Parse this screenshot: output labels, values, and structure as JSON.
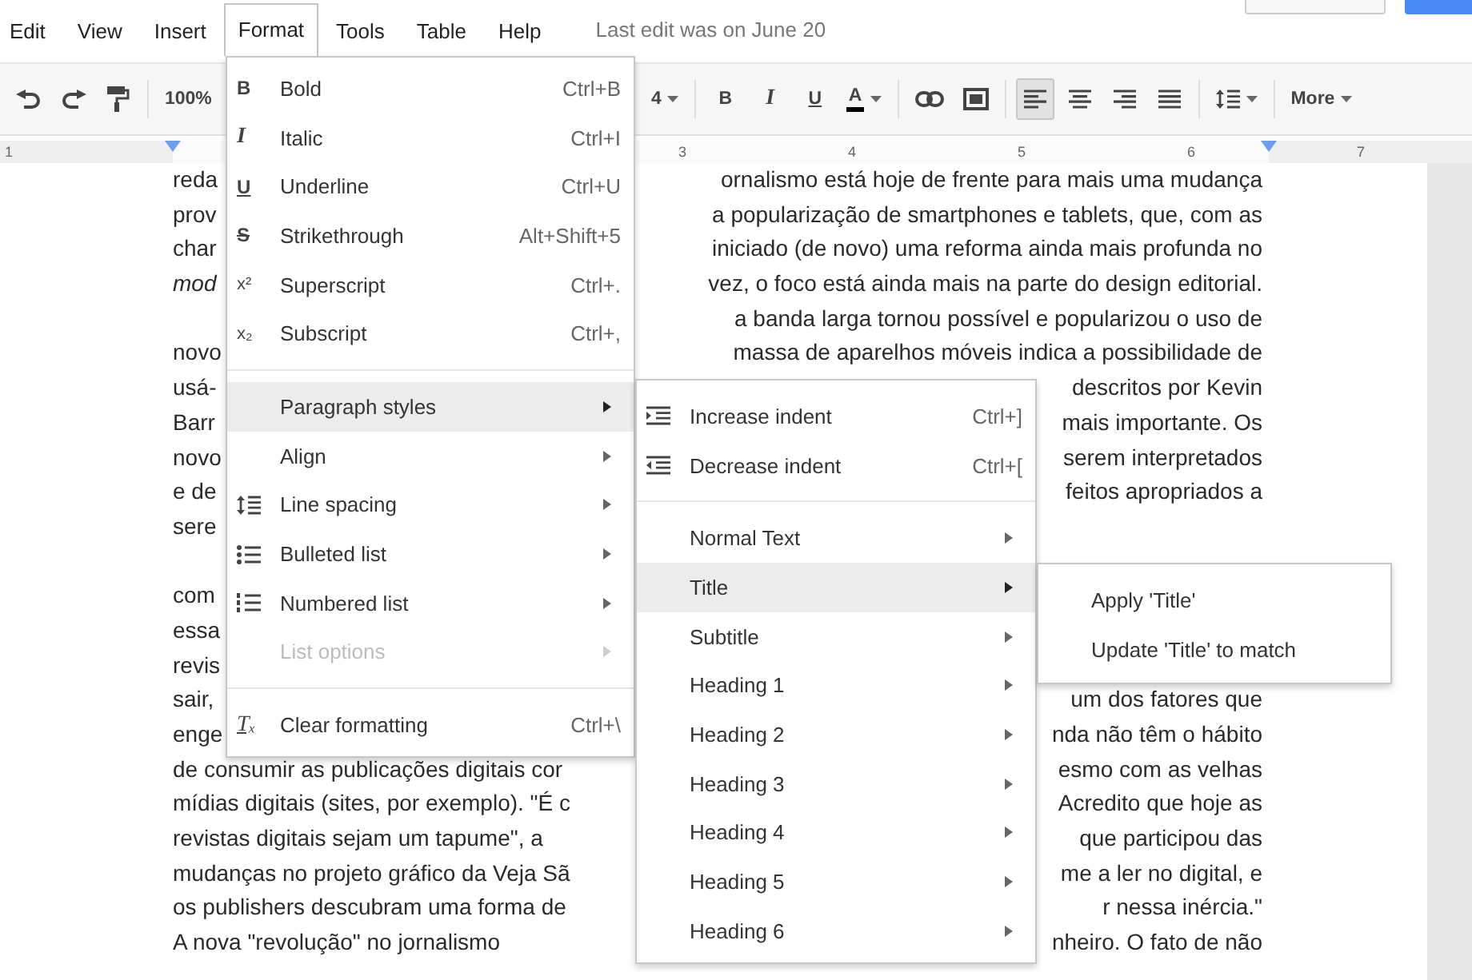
{
  "menubar": {
    "items": [
      {
        "label": "Edit",
        "selected": false
      },
      {
        "label": "View",
        "selected": false
      },
      {
        "label": "Insert",
        "selected": false
      },
      {
        "label": "Format",
        "selected": true
      },
      {
        "label": "Tools",
        "selected": false
      },
      {
        "label": "Table",
        "selected": false
      },
      {
        "label": "Help",
        "selected": false
      }
    ],
    "last_edit": "Last edit was on June 20"
  },
  "toolbar": {
    "left_groups": [
      [
        {
          "kind": "undo"
        },
        {
          "kind": "redo"
        },
        {
          "kind": "paint"
        }
      ],
      [
        {
          "kind": "text",
          "label": "100%"
        }
      ]
    ],
    "right_groups": [
      [
        {
          "kind": "text",
          "label": "4",
          "dropdown": true
        }
      ],
      [
        {
          "kind": "bold",
          "label": "B"
        },
        {
          "kind": "italic",
          "label": "I"
        },
        {
          "kind": "underline",
          "label": "U"
        },
        {
          "kind": "text-color",
          "label": "A",
          "dropdown": true
        }
      ],
      [
        {
          "kind": "link"
        },
        {
          "kind": "image"
        }
      ],
      [
        {
          "kind": "align-left",
          "selected": true
        },
        {
          "kind": "align-center",
          "selected": false
        },
        {
          "kind": "align-right",
          "selected": false
        },
        {
          "kind": "align-justify",
          "selected": false
        }
      ],
      [
        {
          "kind": "line-spacing",
          "dropdown": true
        }
      ],
      [
        {
          "kind": "text",
          "label": "More",
          "dropdown": true
        }
      ]
    ]
  },
  "ruler": {
    "numbers": [
      "1",
      "3",
      "4",
      "5",
      "6",
      "7"
    ]
  },
  "document": {
    "paragraphs": [
      [
        {
          "left": "reda",
          "right": "ornalismo está hoje de frente para mais uma mudança"
        },
        {
          "left": "prov",
          "right": "a popularização de smartphones e tablets, que, com as"
        },
        {
          "left": "char",
          "right": "iniciado (de novo) uma reforma ainda mais profunda no"
        },
        {
          "left": "*mod*",
          "right": "vez, o foco está ainda mais na parte do design editorial."
        },
        {
          "right": "a banda larga tornou possível e popularizou o uso de"
        },
        {
          "left": "novo",
          "right": "massa de aparelhos móveis indica a possibilidade de"
        },
        {
          "left": "usá-",
          "right": "descritos por Kevin"
        },
        {
          "left": "Barr",
          "right": "mais importante. Os"
        },
        {
          "left": "novo",
          "right": "serem interpretados"
        },
        {
          "left": "e de",
          "right": "feitos apropriados a"
        },
        {
          "left": "sere"
        }
      ],
      [
        {
          "left": "com"
        },
        {
          "left": "essa"
        },
        {
          "left": "revis"
        },
        {
          "left": "sair,",
          "right": "um dos fatores que"
        },
        {
          "left": "enge",
          "right": "nda não têm o hábito"
        },
        {
          "left": "de consumir as publicações digitais cor",
          "right": "esmo com as velhas"
        },
        {
          "left": "mídias digitais (sites, por exemplo). \"É c",
          "right": "Acredito que hoje as"
        },
        {
          "left": "revistas digitais sejam um tapume\", a",
          "right": "que participou das"
        },
        {
          "left": "mudanças no projeto gráfico da Veja Sã",
          "right": "me a ler no digital, e"
        },
        {
          "left": "os publishers descubram uma forma de",
          "right": "r nessa inércia.\""
        },
        {
          "left": "A nova \"revolução\" no jornalismo",
          "right": "nheiro. O fato de não"
        }
      ]
    ]
  },
  "format_menu": {
    "groups": [
      [
        {
          "kind": "bold",
          "glyph": "B",
          "label": "Bold",
          "shortcut": "Ctrl+B",
          "highlighted": false,
          "disabled": false,
          "submenu": false
        },
        {
          "kind": "italic",
          "glyph": "I",
          "label": "Italic",
          "shortcut": "Ctrl+I",
          "highlighted": false,
          "disabled": false,
          "submenu": false
        },
        {
          "kind": "underline",
          "glyph": "U",
          "label": "Underline",
          "shortcut": "Ctrl+U",
          "highlighted": false,
          "disabled": false,
          "submenu": false
        },
        {
          "kind": "strike",
          "glyph": "S",
          "label": "Strikethrough",
          "shortcut": "Alt+Shift+5",
          "highlighted": false,
          "disabled": false,
          "submenu": false
        },
        {
          "kind": "superscript",
          "glyph": "x²",
          "label": "Superscript",
          "shortcut": "Ctrl+.",
          "highlighted": false,
          "disabled": false,
          "submenu": false
        },
        {
          "kind": "subscript",
          "glyph": "x₂",
          "label": "Subscript",
          "shortcut": "Ctrl+,",
          "highlighted": false,
          "disabled": false,
          "submenu": false
        }
      ],
      [
        {
          "kind": "plain",
          "label": "Paragraph styles",
          "highlighted": true,
          "disabled": false,
          "submenu": true
        },
        {
          "kind": "plain",
          "label": "Align",
          "highlighted": false,
          "disabled": false,
          "submenu": true
        },
        {
          "kind": "line-spacing",
          "label": "Line spacing",
          "highlighted": false,
          "disabled": false,
          "submenu": true
        },
        {
          "kind": "bulleted",
          "label": "Bulleted list",
          "highlighted": false,
          "disabled": false,
          "submenu": true
        },
        {
          "kind": "numbered",
          "label": "Numbered list",
          "highlighted": false,
          "disabled": false,
          "submenu": true
        },
        {
          "kind": "plain",
          "label": "List options",
          "highlighted": false,
          "disabled": true,
          "submenu": true
        }
      ],
      [
        {
          "kind": "clear",
          "glyph": "Tₓ",
          "label": "Clear formatting",
          "shortcut": "Ctrl+\\",
          "highlighted": false,
          "disabled": false,
          "submenu": false
        }
      ]
    ]
  },
  "paragraph_styles_menu": {
    "groups": [
      [
        {
          "kind": "indent-increase",
          "label": "Increase indent",
          "shortcut": "Ctrl+]",
          "highlighted": false,
          "submenu": false
        },
        {
          "kind": "indent-decrease",
          "label": "Decrease indent",
          "shortcut": "Ctrl+[",
          "highlighted": false,
          "submenu": false
        }
      ],
      [
        {
          "kind": "plain",
          "label": "Normal Text",
          "highlighted": false,
          "submenu": true
        },
        {
          "kind": "plain",
          "label": "Title",
          "highlighted": true,
          "submenu": true
        },
        {
          "kind": "plain",
          "label": "Subtitle",
          "highlighted": false,
          "submenu": true
        },
        {
          "kind": "plain",
          "label": "Heading 1",
          "highlighted": false,
          "submenu": true
        },
        {
          "kind": "plain",
          "label": "Heading 2",
          "highlighted": false,
          "submenu": true
        },
        {
          "kind": "plain",
          "label": "Heading 3",
          "highlighted": false,
          "submenu": true
        },
        {
          "kind": "plain",
          "label": "Heading 4",
          "highlighted": false,
          "submenu": true
        },
        {
          "kind": "plain",
          "label": "Heading 5",
          "highlighted": false,
          "submenu": true
        },
        {
          "kind": "plain",
          "label": "Heading 6",
          "highlighted": false,
          "submenu": true
        }
      ]
    ]
  },
  "title_menu": {
    "groups": [
      [
        {
          "label": "Apply 'Title'",
          "highlighted": false,
          "submenu": false
        },
        {
          "label": "Update 'Title' to match",
          "highlighted": false,
          "submenu": false
        }
      ]
    ]
  }
}
